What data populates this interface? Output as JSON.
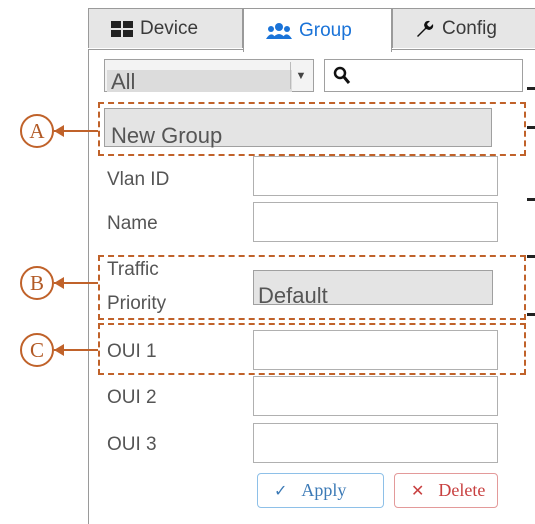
{
  "tabs": [
    {
      "label": "Device",
      "icon": "grid-icon",
      "active": false
    },
    {
      "label": "Group",
      "icon": "users-icon",
      "active": true
    },
    {
      "label": "Config",
      "icon": "wrench-icon",
      "active": false
    }
  ],
  "filter": {
    "selected": "All",
    "search_value": ""
  },
  "group_select": {
    "selected": "New Group"
  },
  "form": {
    "vlan_label": "Vlan ID",
    "vlan_value": "",
    "name_label": "Name",
    "name_value": "",
    "priority_label_line1": "Traffic",
    "priority_label_line2": "Priority",
    "priority_value": "Default",
    "oui1_label": "OUI 1",
    "oui1_value": "",
    "oui2_label": "OUI 2",
    "oui2_value": "",
    "oui3_label": "OUI 3",
    "oui3_value": ""
  },
  "buttons": {
    "apply": "Apply",
    "delete": "Delete"
  },
  "annotations": {
    "a": "A",
    "b": "B",
    "c": "C"
  },
  "colors": {
    "accent": "#1a73d8",
    "annotation": "#c0622a",
    "delete": "#c84040"
  }
}
